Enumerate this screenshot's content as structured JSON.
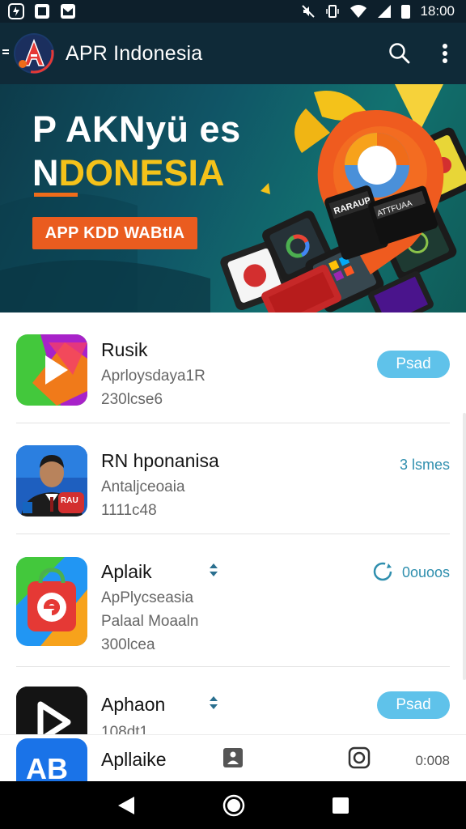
{
  "status_bar": {
    "time": "18:00"
  },
  "app_bar": {
    "title": "APR Indonesia",
    "logo_letter": "A"
  },
  "banner": {
    "line1": "P AKNyü es",
    "line2_white": "N",
    "line2_yellow": "DONESIA",
    "cta_label": "APP KDD WABtIA",
    "device_label_1": "RARAUP",
    "device_label_2": "ATTFUAA"
  },
  "apps": [
    {
      "name": "Rusik",
      "sub1": "Aprloysdaya1R",
      "sub2": "230lcse6",
      "sub3": "",
      "action": "Psad",
      "action_style": "pill"
    },
    {
      "name": "RN hponanisa",
      "sub1": "Antaljceoaia",
      "sub2": "1111c48",
      "sub3": "",
      "action": "3 lsmes",
      "action_style": "text"
    },
    {
      "name": "Aplaik",
      "sub1": "ApPlycseasia",
      "sub2": "Palaal Moaaln",
      "sub3": "300lcea",
      "action": "0ouoos",
      "action_style": "text-icon"
    },
    {
      "name": "Aphaon",
      "sub1": "108dt1",
      "sub2": "",
      "sub3": "",
      "action": "Psad",
      "action_style": "pill"
    }
  ],
  "bottom_item": {
    "name": "Apllaike",
    "meta": "0:008",
    "icon_text": "AB"
  },
  "colors": {
    "status_bar": "#0d1f2b",
    "app_bar": "#0f2a38",
    "banner_yellow": "#f4c21a",
    "cta_orange": "#ea5c1f",
    "pill_blue": "#5fc2ea",
    "link_teal": "#2f8fae"
  },
  "icons": {
    "search": "search-icon",
    "more": "more-vertical-icon",
    "back": "back-triangle-icon",
    "home": "home-circle-icon",
    "recents": "recents-square-icon"
  }
}
